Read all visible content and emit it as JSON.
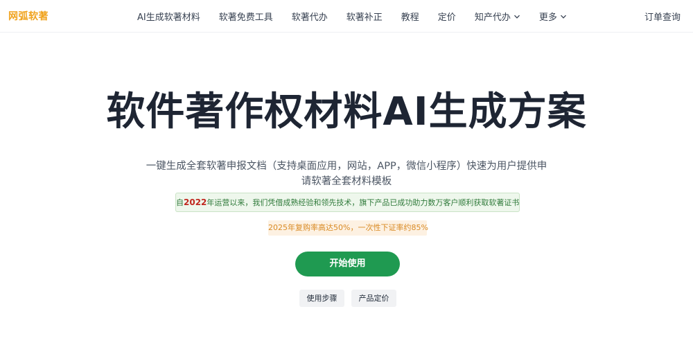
{
  "header": {
    "brand": "网弧软著",
    "nav": [
      {
        "label": "AI生成软著材料"
      },
      {
        "label": "软著免费工具"
      },
      {
        "label": "软著代办"
      },
      {
        "label": "软著补正"
      },
      {
        "label": "教程"
      },
      {
        "label": "定价"
      },
      {
        "label": "知产代办",
        "dropdown": true
      },
      {
        "label": "更多",
        "dropdown": true
      }
    ],
    "order_link": "订单查询"
  },
  "hero": {
    "title": "软件著作权材料AI生成方案",
    "subtitle": "一键生成全套软著申报文档（支持桌面应用，网站，APP，微信小程序）快速为用户提供申请软著全套材料模板",
    "green_note_prefix": "自",
    "green_note_year": "2022",
    "green_note_suffix": "年运营以来，我们凭借成熟经验和领先技术，旗下产品已成功助力数万客户顺利获取软著证书",
    "orange_note": "2025年复购率高达50%，一次性下证率约85%",
    "cta_label": "开始使用",
    "steps_label": "使用步骤",
    "pricing_label": "产品定价"
  },
  "colors": {
    "brand": "#f0a31e",
    "cta": "#1f9a51",
    "highlight_year": "#c0271f"
  }
}
